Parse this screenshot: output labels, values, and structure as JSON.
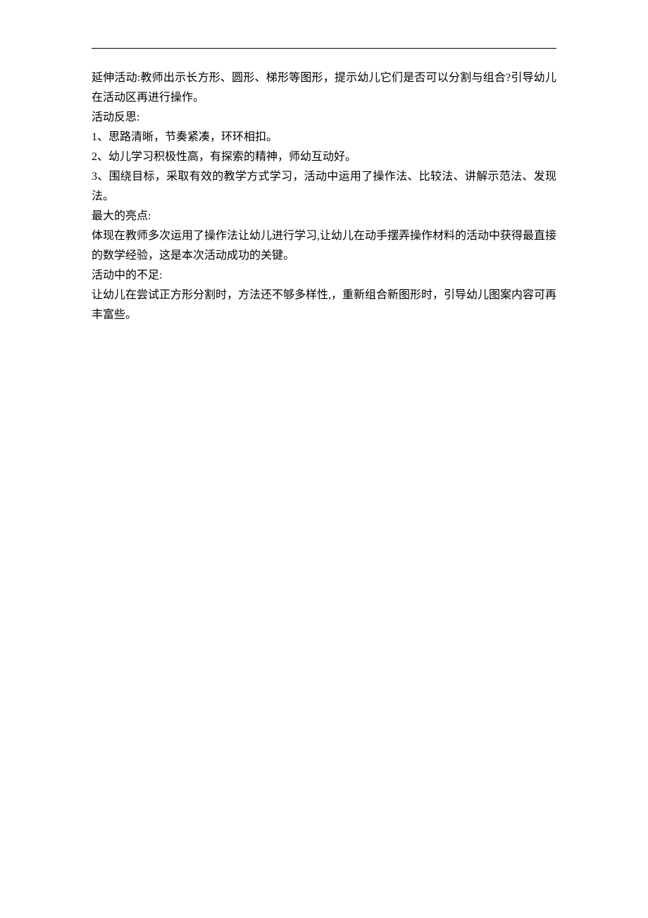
{
  "paragraphs": {
    "p1": "延伸活动:教师出示长方形、圆形、梯形等图形，提示幼儿它们是否可以分割与组合?引导幼儿在活动区再进行操作。",
    "p2": "活动反思:",
    "p3": "1、思路清晰，节奏紧凑，环环相扣。",
    "p4": "2、幼儿学习积极性高，有探索的精神，师幼互动好。",
    "p5": "3、围绕目标，采取有效的教学方式学习，活动中运用了操作法、比较法、讲解示范法、发现法。",
    "p6": "最大的亮点:",
    "p7": "体现在教师多次运用了操作法让幼儿进行学习,让幼儿在动手摆弄操作材料的活动中获得最直接的数学经验，这是本次活动成功的关键。",
    "p8": "活动中的不足:",
    "p9": "让幼儿在尝试正方形分割时，方法还不够多样性,，重新组合新图形时，引导幼儿图案内容可再丰富些。"
  }
}
